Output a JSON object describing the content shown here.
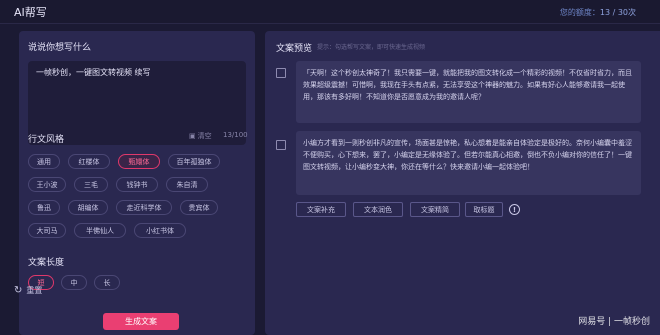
{
  "header": {
    "app_title": "AI帮写",
    "quota_label": "您的额度：",
    "quota_value": "13 / 30次"
  },
  "input_section": {
    "title": "说说你想写什么",
    "text": "一帧秒创，一键图文转视频 续写",
    "clear_label": "清空",
    "counter": "13/100"
  },
  "style_section": {
    "title": "行文风格",
    "chips": [
      "通用",
      "红楼体",
      "甄嬛体",
      "百年孤独体",
      "王小波",
      "三毛",
      "钱钟书",
      "朱自清",
      "鲁迅",
      "胡编体",
      "走近科学体",
      "贵宾体",
      "大司马",
      "半佛仙人",
      "小红书体"
    ],
    "selected": "甄嬛体"
  },
  "length_section": {
    "title": "文案长度",
    "options": [
      "短",
      "中",
      "长"
    ],
    "selected": "短"
  },
  "footer": {
    "reset_label": "重置",
    "generate_label": "生成文案"
  },
  "preview": {
    "title": "文案预览",
    "hint": "提示：勾选帮写文案，即可快速生成视频",
    "cards": [
      {
        "text": "「天啊！这个秒创太神奇了！我只需要一键，就能把我的图文转化成一个精彩的视频！不仅省时省力，而且效果超级震撼！可惜啊，我现在手头有点紧，无法享受这个神器的魅力。如果有好心人能够邀请我一起使用，那该有多好啊！不知道你是否愿意成为我的邀请人呢？"
      },
      {
        "text": "小编方才看到一则秒创非凡的宣传，场面甚是惊艳，私心想着是能亲自体验定是极好的。奈何小编囊中羞涩不便购买，心下想来，罢了，小编定是无缘体验了。但若尔能真心相邀，倒也不负小编对你的信任了！一键图文转视频，让小编秒变大神，你还在等什么？快来邀请小编一起体验吧！"
      }
    ],
    "actions": [
      "文案补充",
      "文本润色",
      "文案精简",
      "取标题"
    ]
  },
  "watermark": "网易号 | 一帧秒创",
  "colors": {
    "accent": "#ea3f72",
    "background": "#1b1a33",
    "panel": "#2a2850",
    "card": "#37355f"
  }
}
